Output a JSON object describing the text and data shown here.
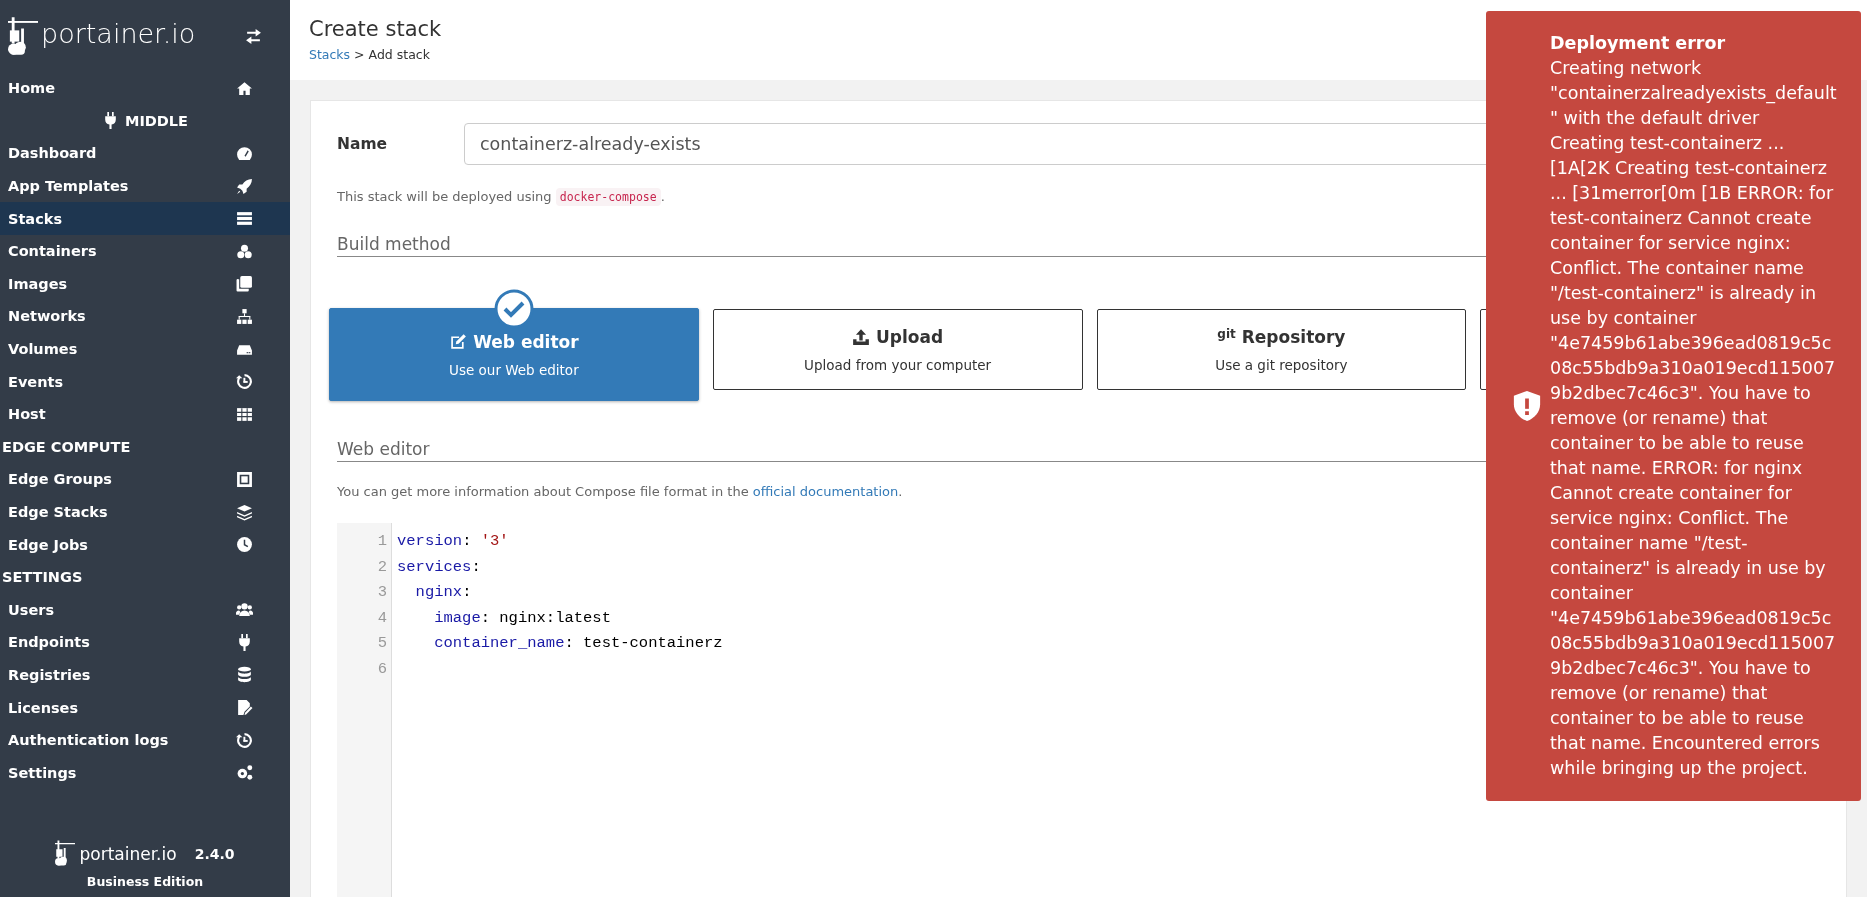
{
  "sidebar": {
    "brand": "portainer.io",
    "items": [
      {
        "kind": "item",
        "label": "Home",
        "selected": false
      },
      {
        "kind": "endpoint",
        "label": "MIDDLE"
      },
      {
        "kind": "item",
        "label": "Dashboard",
        "selected": false
      },
      {
        "kind": "item",
        "label": "App Templates",
        "selected": false
      },
      {
        "kind": "item",
        "label": "Stacks",
        "selected": true
      },
      {
        "kind": "item",
        "label": "Containers",
        "selected": false
      },
      {
        "kind": "item",
        "label": "Images",
        "selected": false
      },
      {
        "kind": "item",
        "label": "Networks",
        "selected": false
      },
      {
        "kind": "item",
        "label": "Volumes",
        "selected": false
      },
      {
        "kind": "item",
        "label": "Events",
        "selected": false
      },
      {
        "kind": "item",
        "label": "Host",
        "selected": false
      },
      {
        "kind": "section",
        "label": "EDGE COMPUTE"
      },
      {
        "kind": "item",
        "label": "Edge Groups",
        "selected": false
      },
      {
        "kind": "item",
        "label": "Edge Stacks",
        "selected": false
      },
      {
        "kind": "item",
        "label": "Edge Jobs",
        "selected": false
      },
      {
        "kind": "section",
        "label": "SETTINGS"
      },
      {
        "kind": "item",
        "label": "Users",
        "selected": false
      },
      {
        "kind": "item",
        "label": "Endpoints",
        "selected": false
      },
      {
        "kind": "item",
        "label": "Registries",
        "selected": false
      },
      {
        "kind": "item",
        "label": "Licenses",
        "selected": false
      },
      {
        "kind": "item",
        "label": "Authentication logs",
        "selected": false
      },
      {
        "kind": "item",
        "label": "Settings",
        "selected": false
      }
    ],
    "footer": {
      "brand": "portainer.io",
      "version": "2.4.0",
      "edition": "Business Edition"
    }
  },
  "header": {
    "title": "Create stack",
    "breadcrumb": [
      {
        "label": "Stacks",
        "kind": "link"
      },
      {
        "label": " > Add stack",
        "kind": "text"
      }
    ]
  },
  "form": {
    "name_label": "Name",
    "name_value": "containerz-already-exists",
    "hint": {
      "before": "This stack will be deployed using ",
      "code": "docker-compose",
      "after": "."
    },
    "build_method_title": "Build method",
    "build_methods": [
      {
        "title": "Web editor",
        "subtitle": "Use our Web editor",
        "selected": true
      },
      {
        "title": "Upload",
        "subtitle": "Upload from your computer",
        "selected": false
      },
      {
        "title": "Repository",
        "icon_text": "git",
        "subtitle": "Use a git repository",
        "selected": false
      },
      {
        "selected": false
      }
    ],
    "editor_title": "Web editor",
    "docs": {
      "before": "You can get more information about Compose file format in the ",
      "link": "official documentation",
      "after": "."
    },
    "editor": {
      "lines": [
        {
          "number": "1",
          "tokens": [
            {
              "kind": "key",
              "text": "version"
            },
            {
              "kind": "plain",
              "text": ": "
            },
            {
              "kind": "string",
              "text": "'3'"
            }
          ]
        },
        {
          "number": "2",
          "tokens": [
            {
              "kind": "key",
              "text": "services"
            },
            {
              "kind": "plain",
              "text": ":"
            }
          ]
        },
        {
          "number": "3",
          "tokens": [
            {
              "kind": "key",
              "text": "  nginx"
            },
            {
              "kind": "plain",
              "text": ":"
            }
          ]
        },
        {
          "number": "4",
          "tokens": [
            {
              "kind": "key",
              "text": "    image"
            },
            {
              "kind": "plain",
              "text": ": nginx:latest"
            }
          ]
        },
        {
          "number": "5",
          "tokens": [
            {
              "kind": "key",
              "text": "    container_name"
            },
            {
              "kind": "plain",
              "text": ": test-containerz"
            }
          ]
        },
        {
          "number": "6"
        }
      ]
    }
  },
  "toast": {
    "kind": "error",
    "title": "Deployment error",
    "message": "Creating network \"containerzalreadyexists_default\" with the default driver Creating test-containerz ... [1A[2K Creating test-containerz ... [31merror[0m [1B ERROR: for test-containerz Cannot create container for service nginx: Conflict. The container name \"/test-containerz\" is already in use by container \"4e7459b61abe396ead0819c5c08c55bdb9a310a019ecd1150079b2dbec7c46c3\". You have to remove (or rename) that container to be able to reuse that name. ERROR: for nginx Cannot create container for service nginx: Conflict. The container name \"/test-containerz\" is already in use by container \"4e7459b61abe396ead0819c5c08c55bdb9a310a019ecd1150079b2dbec7c46c3\". You have to remove (or rename) that container to be able to reuse that name. Encountered errors while bringing up the project."
  }
}
